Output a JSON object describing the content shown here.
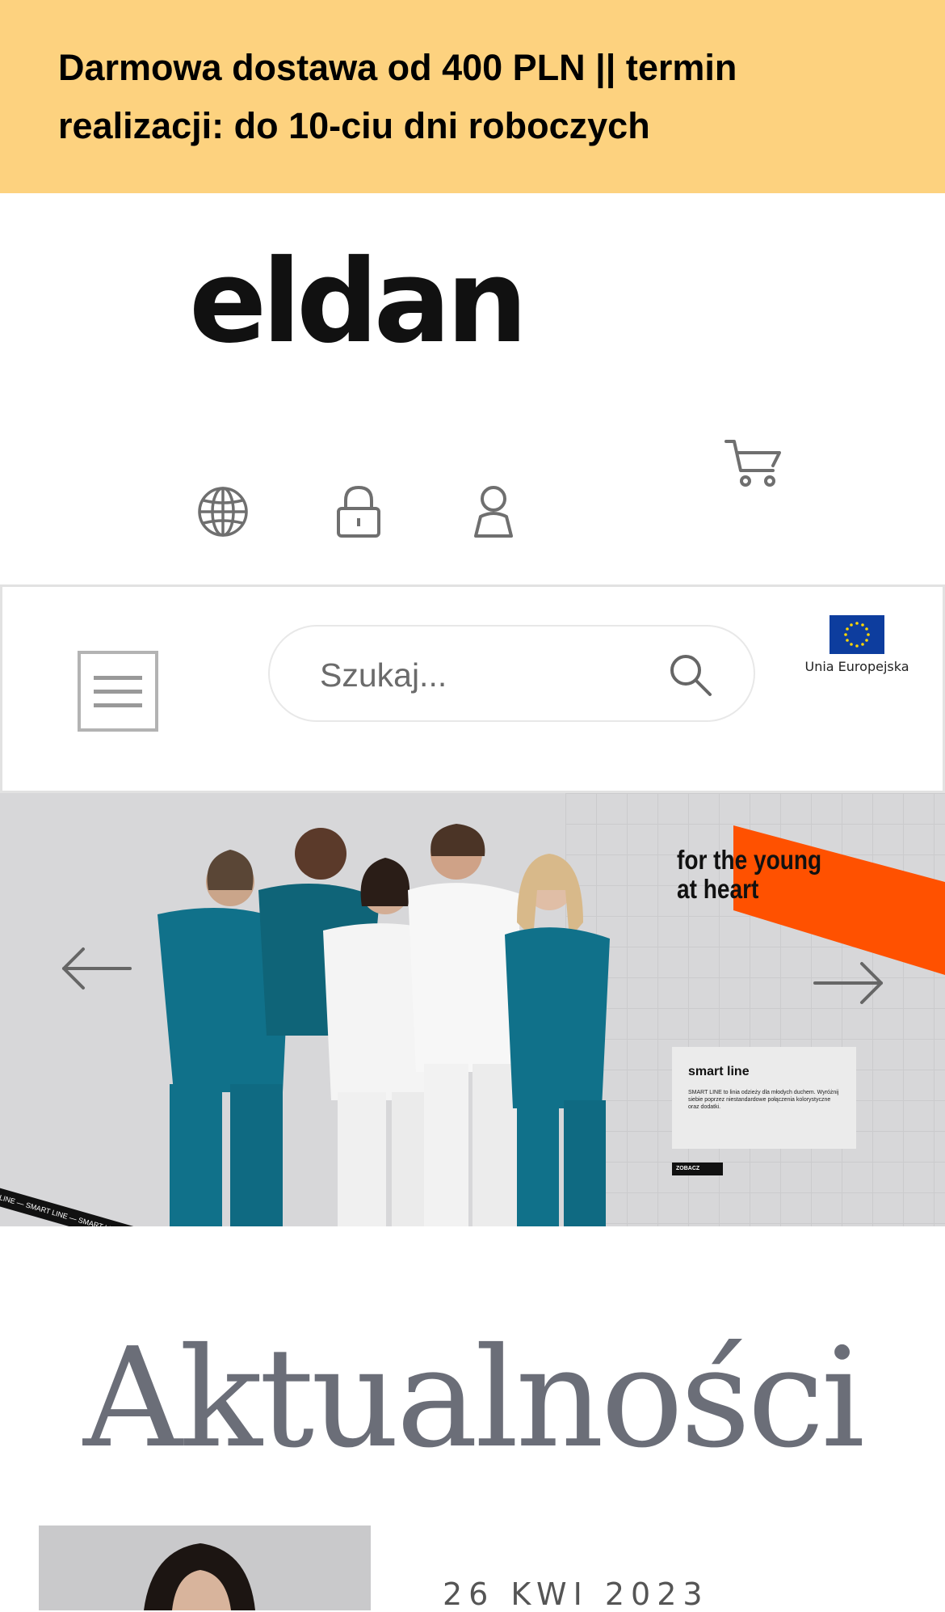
{
  "promo": {
    "text": "Darmowa dostawa od 400 PLN || termin realizacji: do 10-ciu dni roboczych"
  },
  "brand": {
    "logo_text": "eldan"
  },
  "icons": {
    "language": "globe-icon",
    "login": "lock-icon",
    "account": "user-icon",
    "cart": "cart-icon",
    "menu": "hamburger-icon",
    "search": "search-icon"
  },
  "search": {
    "placeholder": "Szukaj..."
  },
  "eu": {
    "label": "Unia Europejska"
  },
  "hero": {
    "tagline_line1": "for the young",
    "tagline_line2": "at heart",
    "card_title": "smart line",
    "card_desc": "SMART LINE to linia odzieży dla młodych duchem. Wyróżnij siebie poprzez niestandardowe połączenia kolorystyczne oraz dodatki.",
    "cta": "ZOBACZ",
    "ribbon": "SMART LINE — SMART LINE — SMART LINE — SMART LINE — SMART LINE — SMART LINE — SMART LINE — SMART",
    "accent_color": "#ff5100",
    "scrub_color": "#10718a"
  },
  "news": {
    "title": "Aktualności",
    "first_date": "26 KWI 2023"
  },
  "colors": {
    "promo_bg": "#fdd27f"
  }
}
